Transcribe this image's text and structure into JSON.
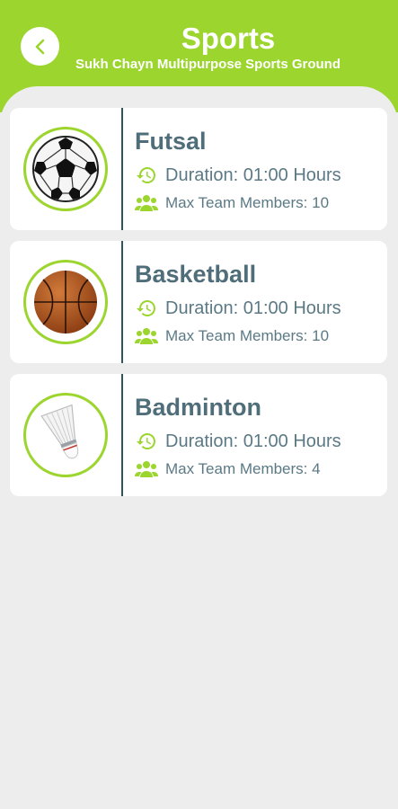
{
  "header": {
    "title": "Sports",
    "subtitle": "Sukh Chayn Multipurpose Sports Ground"
  },
  "colors": {
    "accent": "#9bd52e",
    "text": "#4f6e79",
    "divider": "#2f5562",
    "background": "#ededed"
  },
  "sports": [
    {
      "name": "Futsal",
      "duration": "Duration: 01:00 Hours",
      "members": "Max Team Members: 10",
      "icon": "soccer-ball-icon"
    },
    {
      "name": "Basketball",
      "duration": "Duration: 01:00 Hours",
      "members": "Max Team Members: 10",
      "icon": "basketball-icon"
    },
    {
      "name": "Badminton",
      "duration": "Duration: 01:00 Hours",
      "members": "Max Team Members: 4",
      "icon": "shuttlecock-icon"
    }
  ]
}
